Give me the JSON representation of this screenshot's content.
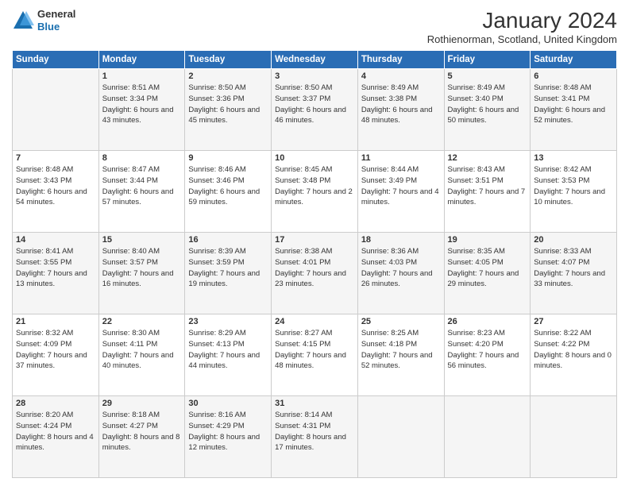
{
  "header": {
    "logo_general": "General",
    "logo_blue": "Blue",
    "title": "January 2024",
    "location": "Rothienorman, Scotland, United Kingdom"
  },
  "days_of_week": [
    "Sunday",
    "Monday",
    "Tuesday",
    "Wednesday",
    "Thursday",
    "Friday",
    "Saturday"
  ],
  "weeks": [
    [
      {
        "num": "",
        "sunrise": "",
        "sunset": "",
        "daylight": ""
      },
      {
        "num": "1",
        "sunrise": "Sunrise: 8:51 AM",
        "sunset": "Sunset: 3:34 PM",
        "daylight": "Daylight: 6 hours and 43 minutes."
      },
      {
        "num": "2",
        "sunrise": "Sunrise: 8:50 AM",
        "sunset": "Sunset: 3:36 PM",
        "daylight": "Daylight: 6 hours and 45 minutes."
      },
      {
        "num": "3",
        "sunrise": "Sunrise: 8:50 AM",
        "sunset": "Sunset: 3:37 PM",
        "daylight": "Daylight: 6 hours and 46 minutes."
      },
      {
        "num": "4",
        "sunrise": "Sunrise: 8:49 AM",
        "sunset": "Sunset: 3:38 PM",
        "daylight": "Daylight: 6 hours and 48 minutes."
      },
      {
        "num": "5",
        "sunrise": "Sunrise: 8:49 AM",
        "sunset": "Sunset: 3:40 PM",
        "daylight": "Daylight: 6 hours and 50 minutes."
      },
      {
        "num": "6",
        "sunrise": "Sunrise: 8:48 AM",
        "sunset": "Sunset: 3:41 PM",
        "daylight": "Daylight: 6 hours and 52 minutes."
      }
    ],
    [
      {
        "num": "7",
        "sunrise": "Sunrise: 8:48 AM",
        "sunset": "Sunset: 3:43 PM",
        "daylight": "Daylight: 6 hours and 54 minutes."
      },
      {
        "num": "8",
        "sunrise": "Sunrise: 8:47 AM",
        "sunset": "Sunset: 3:44 PM",
        "daylight": "Daylight: 6 hours and 57 minutes."
      },
      {
        "num": "9",
        "sunrise": "Sunrise: 8:46 AM",
        "sunset": "Sunset: 3:46 PM",
        "daylight": "Daylight: 6 hours and 59 minutes."
      },
      {
        "num": "10",
        "sunrise": "Sunrise: 8:45 AM",
        "sunset": "Sunset: 3:48 PM",
        "daylight": "Daylight: 7 hours and 2 minutes."
      },
      {
        "num": "11",
        "sunrise": "Sunrise: 8:44 AM",
        "sunset": "Sunset: 3:49 PM",
        "daylight": "Daylight: 7 hours and 4 minutes."
      },
      {
        "num": "12",
        "sunrise": "Sunrise: 8:43 AM",
        "sunset": "Sunset: 3:51 PM",
        "daylight": "Daylight: 7 hours and 7 minutes."
      },
      {
        "num": "13",
        "sunrise": "Sunrise: 8:42 AM",
        "sunset": "Sunset: 3:53 PM",
        "daylight": "Daylight: 7 hours and 10 minutes."
      }
    ],
    [
      {
        "num": "14",
        "sunrise": "Sunrise: 8:41 AM",
        "sunset": "Sunset: 3:55 PM",
        "daylight": "Daylight: 7 hours and 13 minutes."
      },
      {
        "num": "15",
        "sunrise": "Sunrise: 8:40 AM",
        "sunset": "Sunset: 3:57 PM",
        "daylight": "Daylight: 7 hours and 16 minutes."
      },
      {
        "num": "16",
        "sunrise": "Sunrise: 8:39 AM",
        "sunset": "Sunset: 3:59 PM",
        "daylight": "Daylight: 7 hours and 19 minutes."
      },
      {
        "num": "17",
        "sunrise": "Sunrise: 8:38 AM",
        "sunset": "Sunset: 4:01 PM",
        "daylight": "Daylight: 7 hours and 23 minutes."
      },
      {
        "num": "18",
        "sunrise": "Sunrise: 8:36 AM",
        "sunset": "Sunset: 4:03 PM",
        "daylight": "Daylight: 7 hours and 26 minutes."
      },
      {
        "num": "19",
        "sunrise": "Sunrise: 8:35 AM",
        "sunset": "Sunset: 4:05 PM",
        "daylight": "Daylight: 7 hours and 29 minutes."
      },
      {
        "num": "20",
        "sunrise": "Sunrise: 8:33 AM",
        "sunset": "Sunset: 4:07 PM",
        "daylight": "Daylight: 7 hours and 33 minutes."
      }
    ],
    [
      {
        "num": "21",
        "sunrise": "Sunrise: 8:32 AM",
        "sunset": "Sunset: 4:09 PM",
        "daylight": "Daylight: 7 hours and 37 minutes."
      },
      {
        "num": "22",
        "sunrise": "Sunrise: 8:30 AM",
        "sunset": "Sunset: 4:11 PM",
        "daylight": "Daylight: 7 hours and 40 minutes."
      },
      {
        "num": "23",
        "sunrise": "Sunrise: 8:29 AM",
        "sunset": "Sunset: 4:13 PM",
        "daylight": "Daylight: 7 hours and 44 minutes."
      },
      {
        "num": "24",
        "sunrise": "Sunrise: 8:27 AM",
        "sunset": "Sunset: 4:15 PM",
        "daylight": "Daylight: 7 hours and 48 minutes."
      },
      {
        "num": "25",
        "sunrise": "Sunrise: 8:25 AM",
        "sunset": "Sunset: 4:18 PM",
        "daylight": "Daylight: 7 hours and 52 minutes."
      },
      {
        "num": "26",
        "sunrise": "Sunrise: 8:23 AM",
        "sunset": "Sunset: 4:20 PM",
        "daylight": "Daylight: 7 hours and 56 minutes."
      },
      {
        "num": "27",
        "sunrise": "Sunrise: 8:22 AM",
        "sunset": "Sunset: 4:22 PM",
        "daylight": "Daylight: 8 hours and 0 minutes."
      }
    ],
    [
      {
        "num": "28",
        "sunrise": "Sunrise: 8:20 AM",
        "sunset": "Sunset: 4:24 PM",
        "daylight": "Daylight: 8 hours and 4 minutes."
      },
      {
        "num": "29",
        "sunrise": "Sunrise: 8:18 AM",
        "sunset": "Sunset: 4:27 PM",
        "daylight": "Daylight: 8 hours and 8 minutes."
      },
      {
        "num": "30",
        "sunrise": "Sunrise: 8:16 AM",
        "sunset": "Sunset: 4:29 PM",
        "daylight": "Daylight: 8 hours and 12 minutes."
      },
      {
        "num": "31",
        "sunrise": "Sunrise: 8:14 AM",
        "sunset": "Sunset: 4:31 PM",
        "daylight": "Daylight: 8 hours and 17 minutes."
      },
      {
        "num": "",
        "sunrise": "",
        "sunset": "",
        "daylight": ""
      },
      {
        "num": "",
        "sunrise": "",
        "sunset": "",
        "daylight": ""
      },
      {
        "num": "",
        "sunrise": "",
        "sunset": "",
        "daylight": ""
      }
    ]
  ]
}
